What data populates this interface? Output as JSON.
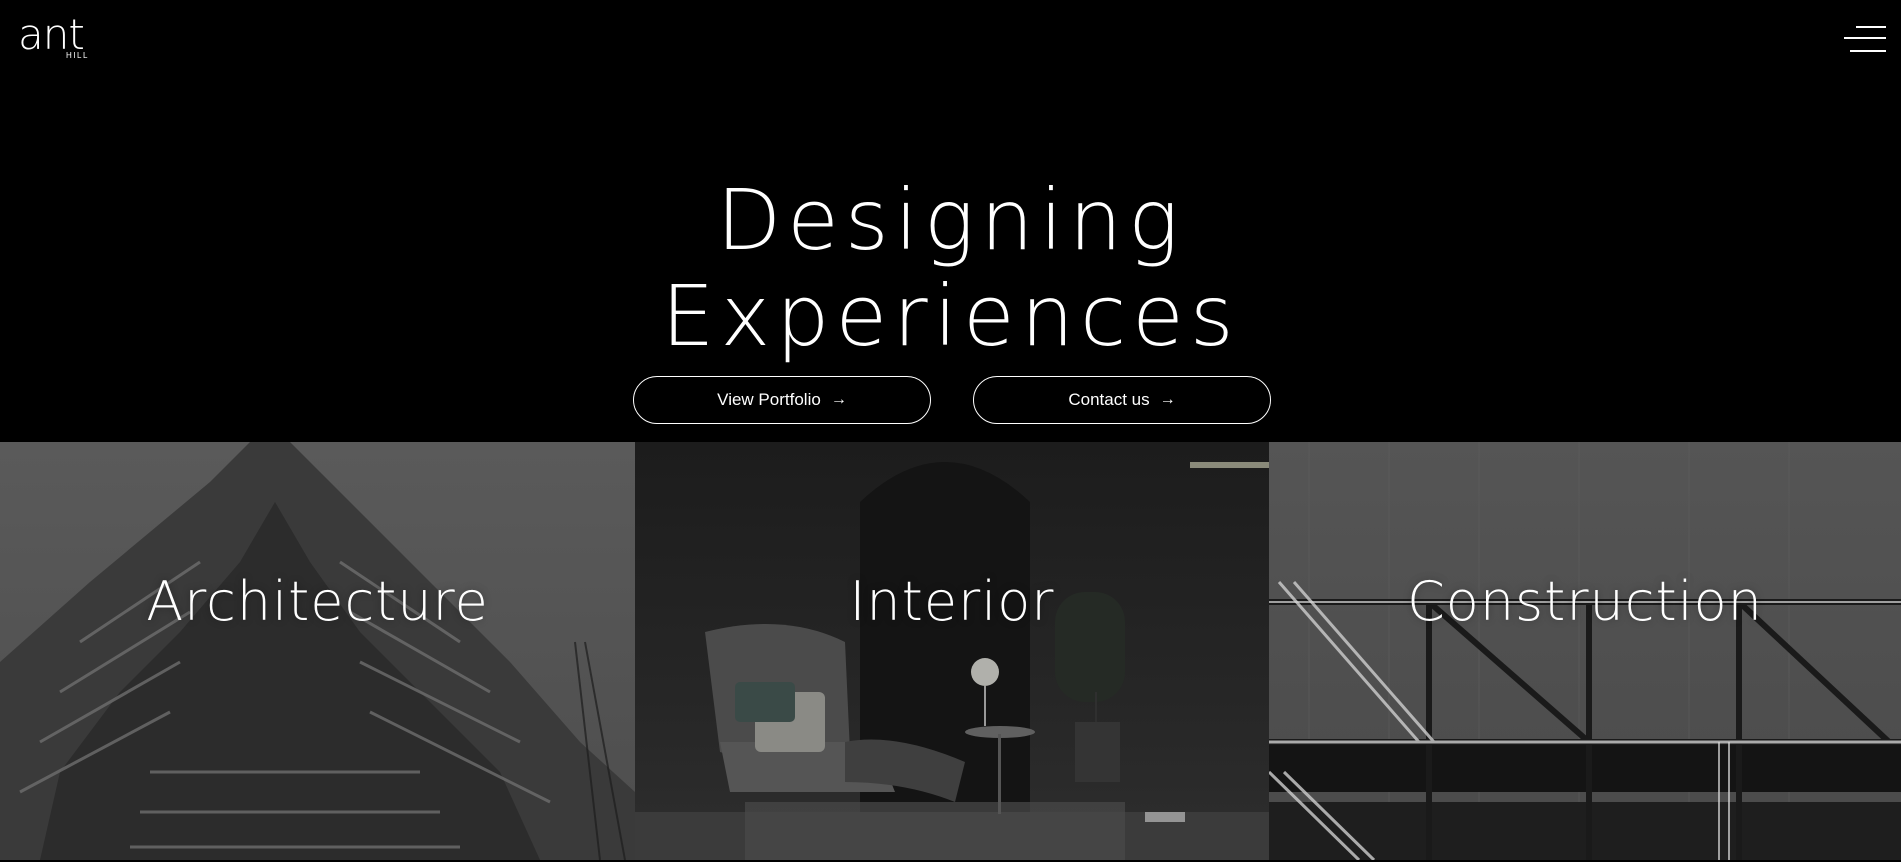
{
  "brand": {
    "logo_text": "ant",
    "logo_subtext": "HILL"
  },
  "header": {
    "menu_icon": "hamburger-menu-icon"
  },
  "hero": {
    "title_line1": "Designing",
    "title_line2": "Experiences",
    "buttons": [
      {
        "label": "View Portfolio",
        "icon": "arrow-right-icon",
        "icon_glyph": "→"
      },
      {
        "label": "Contact us",
        "icon": "arrow-right-icon",
        "icon_glyph": "→"
      }
    ]
  },
  "categories": [
    {
      "label": "Architecture"
    },
    {
      "label": "Interior"
    },
    {
      "label": "Construction"
    }
  ],
  "colors": {
    "background": "#000000",
    "text": "#ffffff"
  }
}
